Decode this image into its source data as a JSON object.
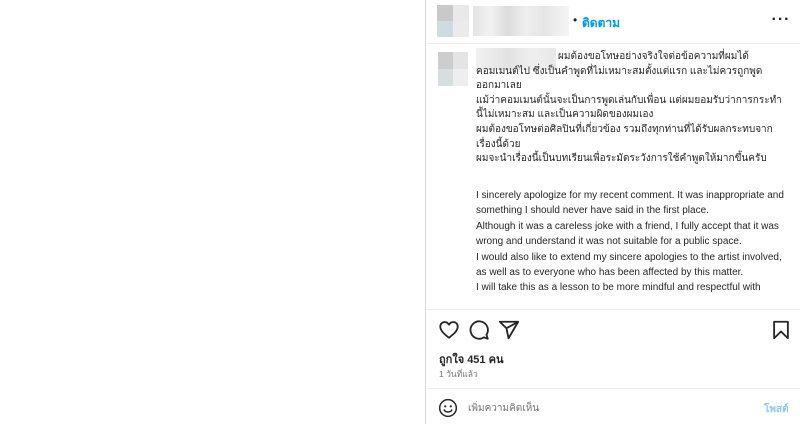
{
  "header": {
    "follow_label": "ติดตาม",
    "dot": "•",
    "more_label": "···"
  },
  "caption": {
    "thai_lines": [
      "ผมต้องขอโทษอย่างจริงใจต่อข้อความที่ผมได้",
      "คอมเมนต์ไป ซึ่งเป็นคำพูดที่ไม่เหมาะสมตั้งแต่แรก และไม่ควรถูกพูด",
      "ออกมาเลย",
      "แม้ว่าคอมเมนต์นั้นจะเป็นการพูดเล่นกับเพื่อน แต่ผมยอมรับว่าการกระทำ",
      "นี้ไม่เหมาะสม และเป็นความผิดของผมเอง",
      "ผมต้องขอโทษต่อศิลปินที่เกี่ยวข้อง รวมถึงทุกท่านที่ได้รับผลกระทบจาก",
      "เรื่องนี้ด้วย",
      "ผมจะนำเรื่องนี้เป็นบทเรียนเพื่อระมัดระวังการใช้คำพูดให้มากขึ้นครับ"
    ],
    "english_paragraphs": [
      "I sincerely apologize for my recent comment. It was inappropriate and something I should never have said in the first place.",
      "Although it was a careless joke with a friend, I fully accept that it was wrong and understand it was not suitable for a public space.",
      "I would also like to extend my sincere apologies to the artist involved, as well as to everyone who has been affected by this matter.",
      "I will take this as a lesson to be more mindful and respectful with"
    ]
  },
  "actions": {
    "like_icon": "heart-icon",
    "comment_icon": "comment-icon",
    "share_icon": "paper-plane-icon",
    "save_icon": "bookmark-icon"
  },
  "stats": {
    "likes_text": "ถูกใจ 451 คน",
    "time_text": "1 วันที่แล้ว"
  },
  "comment": {
    "placeholder": "เพิ่มความคิดเห็น",
    "post_label": "โพสต์"
  },
  "colors": {
    "accent": "#0095f6",
    "post_disabled": "#8ec5f6",
    "text": "#262626",
    "muted": "#737373",
    "divider": "#efefef"
  }
}
